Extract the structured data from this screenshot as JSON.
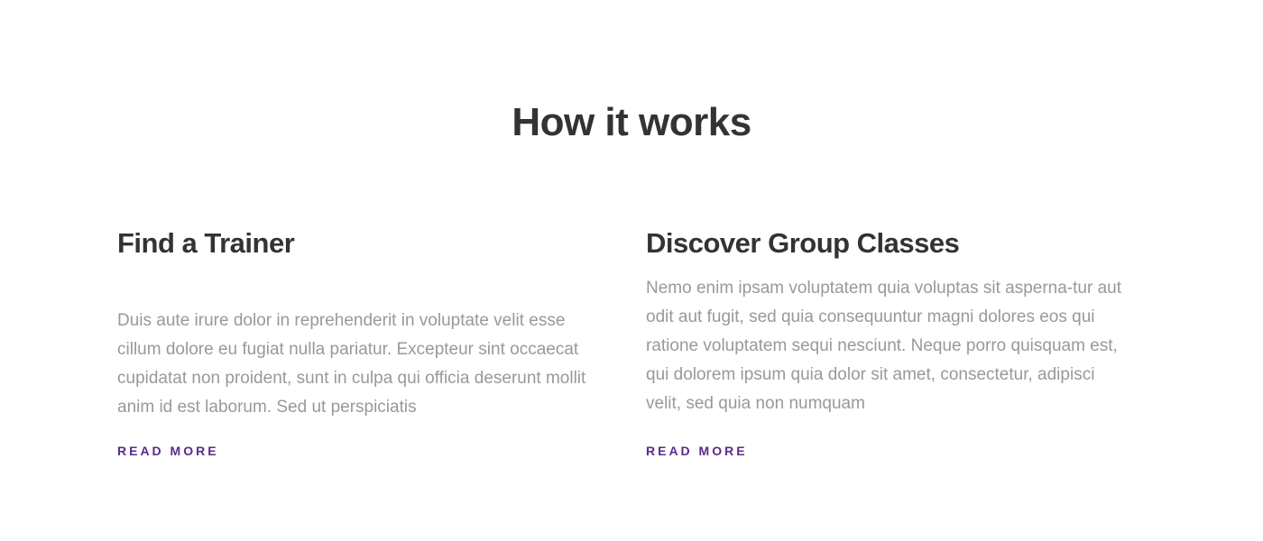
{
  "section": {
    "title": "How it works"
  },
  "features": [
    {
      "title": "Find a Trainer",
      "text": "Duis aute irure dolor in reprehenderit in voluptate velit esse cillum dolore eu fugiat nulla pariatur. Excepteur sint occaecat cupidatat non proident, sunt in culpa qui officia deserunt mollit anim id est laborum. Sed ut perspiciatis",
      "link_label": "READ MORE"
    },
    {
      "title": "Discover Group Classes",
      "text": "Nemo enim ipsam voluptatem quia voluptas sit asperna-tur aut odit aut fugit, sed quia consequuntur magni dolores eos qui ratione voluptatem sequi nesciunt. Neque porro quisquam est, qui dolorem ipsum quia dolor sit amet, consectetur, adipisci velit, sed quia non numquam",
      "link_label": "READ MORE"
    }
  ],
  "colors": {
    "heading": "#333333",
    "body_text": "#999999",
    "accent": "#5b2a8c",
    "background": "#ffffff"
  }
}
